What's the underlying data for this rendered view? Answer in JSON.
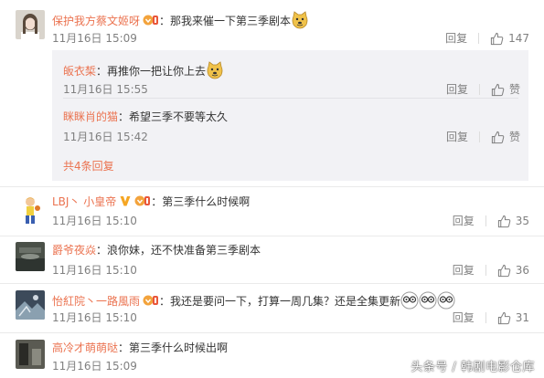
{
  "comments": [
    {
      "username": "保护我方蔡文姬呀",
      "text": "：那我来催一下第三季剧本",
      "time": "11月16日 15:09",
      "reply_label": "回复",
      "like_count": "147",
      "replies": [
        {
          "username": "皈衣椞",
          "text": "：再推你一把让你上去",
          "time": "11月16日 15:55",
          "reply_label": "回复",
          "like_label": "赞"
        },
        {
          "username": "眯眯肖的猫",
          "text": "：希望三季不要等太久",
          "time": "11月16日 15:42",
          "reply_label": "回复",
          "like_label": "赞"
        }
      ],
      "more_replies": "共4条回复"
    },
    {
      "username": "LBJ丶 小皇帝",
      "text": "：第三季什么时候啊",
      "time": "11月16日 15:10",
      "reply_label": "回复",
      "like_count": "35"
    },
    {
      "username": "爵爷夜焱",
      "text": "：浪你妹，还不快准备第三季剧本",
      "time": "11月16日 15:10",
      "reply_label": "回复",
      "like_count": "36"
    },
    {
      "username": "怡紅院丶一路風雨",
      "text": "：我还是要问一下，打算一周几集？还是全集更新",
      "time": "11月16日 15:10",
      "reply_label": "回复",
      "like_count": "31"
    },
    {
      "username": "高冷才萌萌哒",
      "text": "：第三季什么时候出啊",
      "time": "11月16日 15:09"
    }
  ],
  "watermark": "头条号 / 韩剧电影仓库",
  "colors": {
    "username": "#eb7350",
    "time": "#808080",
    "reply_bg": "#f2f2f5"
  }
}
